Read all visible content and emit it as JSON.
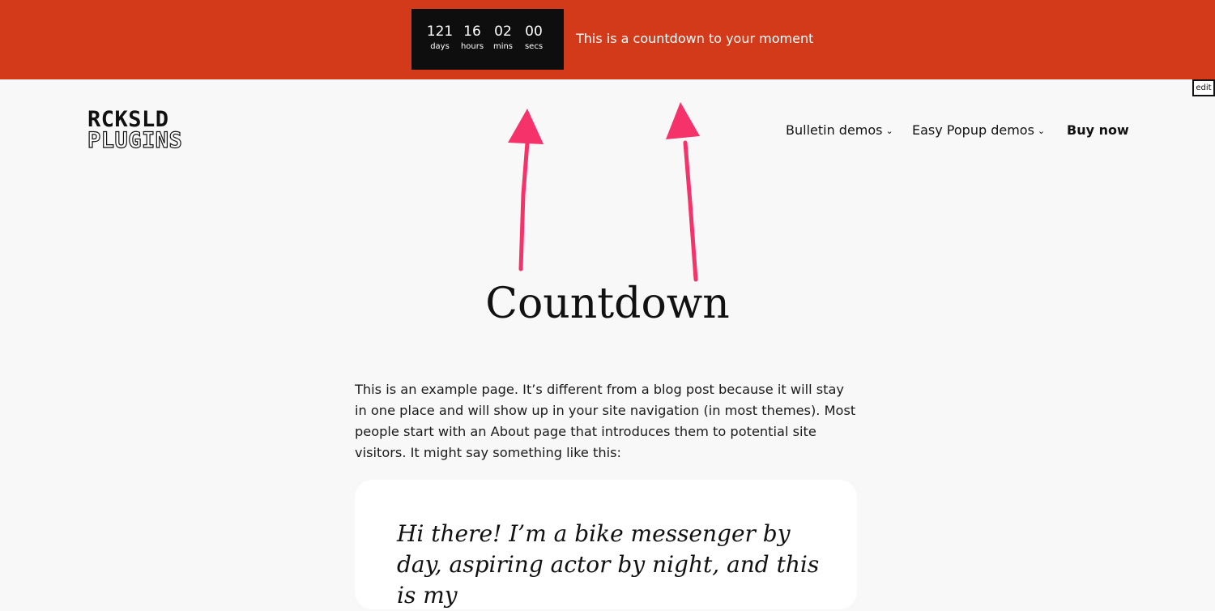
{
  "topbar": {
    "countdown": [
      {
        "value": "121",
        "label": "days"
      },
      {
        "value": "16",
        "label": "hours"
      },
      {
        "value": "02",
        "label": "mins"
      },
      {
        "value": "00",
        "label": "secs"
      }
    ],
    "message": "This is a countdown to your moment",
    "bg_color": "#d23a1a"
  },
  "edit_label": "edit",
  "header": {
    "logo_line1": "RCKSLD",
    "logo_line2": "PLUGINS",
    "nav": [
      {
        "label": "Bulletin demos",
        "has_dropdown": true
      },
      {
        "label": "Easy Popup demos",
        "has_dropdown": true
      },
      {
        "label": "Buy now",
        "has_dropdown": false
      }
    ]
  },
  "main": {
    "title": "Countdown",
    "intro": "This is an example page. It’s different from a blog post because it will stay in one place and will show up in your site navigation (in most themes). Most people start with an About page that introduces them to potential site visitors. It might say something like this:",
    "quote": "Hi there! I’m a bike messenger by day, aspiring actor by night, and this is my"
  },
  "annotation_arrow_color": "#f5336a"
}
